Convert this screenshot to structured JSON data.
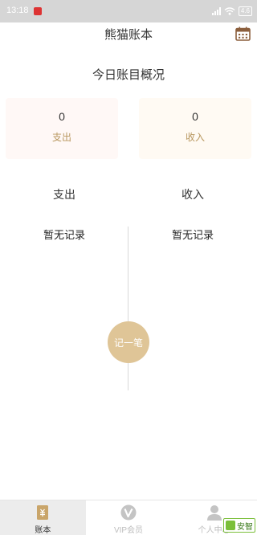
{
  "status_bar": {
    "time": "13:18",
    "battery": "4.6"
  },
  "header": {
    "title": "熊猫账本",
    "calendar_icon": "calendar-icon"
  },
  "overview": {
    "title": "今日账目概况",
    "expense_value": "0",
    "expense_label": "支出",
    "income_value": "0",
    "income_label": "收入"
  },
  "columns": {
    "expense_heading": "支出",
    "income_heading": "收入",
    "expense_empty": "暂无记录",
    "income_empty": "暂无记录"
  },
  "add_button": {
    "label": "记一笔"
  },
  "tabbar": {
    "items": [
      {
        "label": "账本",
        "icon": "ledger-icon",
        "active": true
      },
      {
        "label": "VIP会员",
        "icon": "vip-icon",
        "active": false
      },
      {
        "label": "个人中心",
        "icon": "user-icon",
        "active": false
      }
    ]
  },
  "watermark": {
    "text": "安智"
  },
  "colors": {
    "accent": "#dfc597",
    "label_gold": "#b8975f",
    "calendar": "#8b5e3c"
  }
}
